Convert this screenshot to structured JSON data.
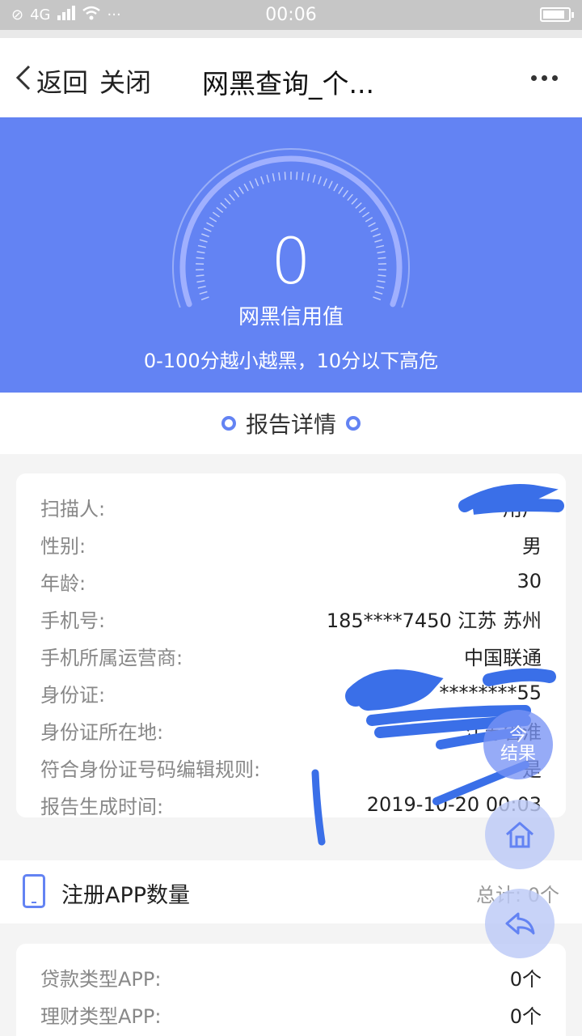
{
  "status_bar": {
    "time": "00:06",
    "network": "4G",
    "more": "···",
    "battery_level": 0.85
  },
  "nav": {
    "back_label": "返回",
    "close_label": "关闭",
    "title": "网黑查询_个..."
  },
  "hero": {
    "score": "0",
    "score_label": "网黑信用值",
    "description": "0-100分越小越黑，10分以下高危",
    "score_fraction": 0,
    "accent_color": "#6383f3"
  },
  "report": {
    "section_title": "报告详情",
    "rows": [
      {
        "label": "扫描人:",
        "value": "用户"
      },
      {
        "label": "性别:",
        "value": "男"
      },
      {
        "label": "年龄:",
        "value": "30"
      },
      {
        "label": "手机号:",
        "value": "185****7450 江苏 苏州"
      },
      {
        "label": "手机所属运营商:",
        "value": "中国联通"
      },
      {
        "label": "身份证:",
        "value": "********55"
      },
      {
        "label": "身份证所在地:",
        "value": "江苏省淮"
      },
      {
        "label": "符合身份证号码编辑规则:",
        "value": "是"
      },
      {
        "label": "报告生成时间:",
        "value": "2019-10-20 00:03"
      }
    ]
  },
  "apps": {
    "title": "注册APP数量",
    "total_label": "总计:",
    "total_value": "0个",
    "rows": [
      {
        "label": "贷款类型APP:",
        "value": "0个"
      },
      {
        "label": "理财类型APP:",
        "value": "0个"
      }
    ]
  },
  "fab": {
    "result_label": "今\n结果"
  }
}
